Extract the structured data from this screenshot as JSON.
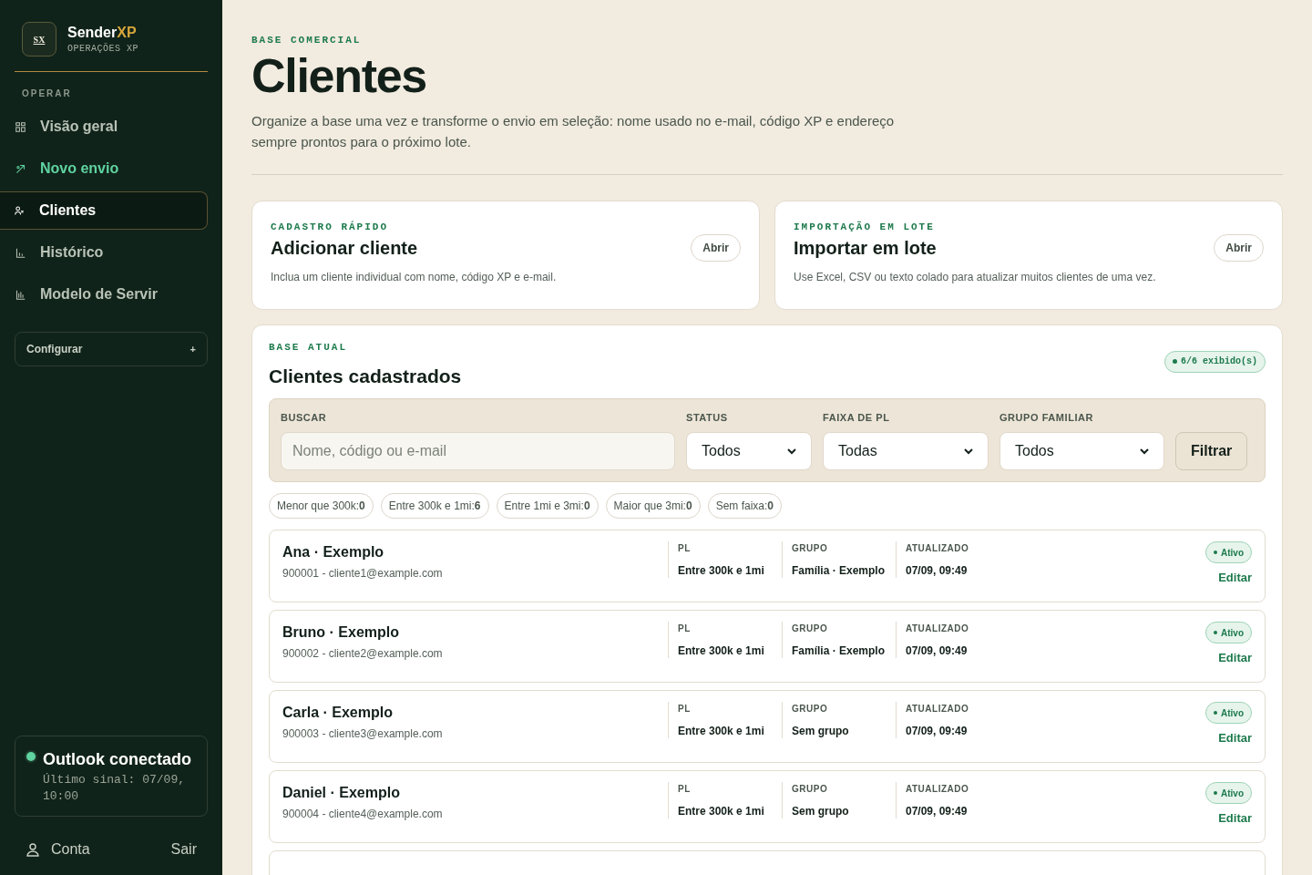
{
  "brand": {
    "logo": "SX",
    "name": "Sender",
    "name_accent": "XP",
    "subtitle": "OPERAÇÕES XP"
  },
  "sidebar": {
    "section": "OPERAR",
    "items": [
      {
        "label": "Visão geral",
        "selected": false,
        "accent": false
      },
      {
        "label": "Novo envio",
        "selected": false,
        "accent": true
      },
      {
        "label": "Clientes",
        "selected": true,
        "accent": false
      },
      {
        "label": "Histórico",
        "selected": false,
        "accent": false
      },
      {
        "label": "Modelo de Servir",
        "selected": false,
        "accent": false
      }
    ],
    "configure": {
      "label": "Configurar",
      "toggle": "+"
    },
    "status": {
      "title": "Outlook conectado",
      "detail": "Último sinal: 07/09, 10:00",
      "color": "#5fd3a0"
    },
    "account": "Conta",
    "logout": "Sair"
  },
  "header": {
    "eyebrow": "BASE COMERCIAL",
    "title": "Clientes",
    "description": "Organize a base uma vez e transforme o envio em seleção: nome usado no e-mail, código XP e endereço sempre prontos para o próximo lote."
  },
  "actions": [
    {
      "eyebrow": "CADASTRO RÁPIDO",
      "title": "Adicionar cliente",
      "description": "Inclua um cliente individual com nome, código XP e e-mail.",
      "button": "Abrir"
    },
    {
      "eyebrow": "IMPORTAÇÃO EM LOTE",
      "title": "Importar em lote",
      "description": "Use Excel, CSV ou texto colado para atualizar muitos clientes de uma vez.",
      "button": "Abrir"
    }
  ],
  "base": {
    "eyebrow": "BASE ATUAL",
    "title": "Clientes cadastrados",
    "count": "6/6 exibido(s)",
    "filters": {
      "search": {
        "label": "BUSCAR",
        "placeholder": "Nome, código ou e-mail"
      },
      "selects": [
        {
          "label": "STATUS",
          "value": "Todos"
        },
        {
          "label": "FAIXA DE PL",
          "value": "Todas"
        },
        {
          "label": "GRUPO FAMILIAR",
          "value": "Todos"
        }
      ],
      "button": "Filtrar"
    },
    "ranges": [
      {
        "label": "Menor que 300k:",
        "count": "0"
      },
      {
        "label": "Entre 300k e 1mi:",
        "count": "6"
      },
      {
        "label": "Entre 1mi e 3mi:",
        "count": "0"
      },
      {
        "label": "Maior que 3mi:",
        "count": "0"
      },
      {
        "label": "Sem faixa:",
        "count": "0"
      }
    ],
    "rows": [
      {
        "name": "Ana · Exemplo",
        "detail": "900001 - cliente1@example.com",
        "fields": [
          {
            "label": "PL",
            "value": "Entre 300k e 1mi"
          },
          {
            "label": "GRUPO",
            "value": "Família · Exemplo"
          },
          {
            "label": "ATUALIZADO",
            "value": "07/09, 09:49"
          }
        ],
        "status": "Ativo",
        "edit": "Editar"
      },
      {
        "name": "Bruno · Exemplo",
        "detail": "900002 - cliente2@example.com",
        "fields": [
          {
            "label": "PL",
            "value": "Entre 300k e 1mi"
          },
          {
            "label": "GRUPO",
            "value": "Família · Exemplo"
          },
          {
            "label": "ATUALIZADO",
            "value": "07/09, 09:49"
          }
        ],
        "status": "Ativo",
        "edit": "Editar"
      },
      {
        "name": "Carla · Exemplo",
        "detail": "900003 - cliente3@example.com",
        "fields": [
          {
            "label": "PL",
            "value": "Entre 300k e 1mi"
          },
          {
            "label": "GRUPO",
            "value": "Sem grupo"
          },
          {
            "label": "ATUALIZADO",
            "value": "07/09, 09:49"
          }
        ],
        "status": "Ativo",
        "edit": "Editar"
      },
      {
        "name": "Daniel · Exemplo",
        "detail": "900004 - cliente4@example.com",
        "fields": [
          {
            "label": "PL",
            "value": "Entre 300k e 1mi"
          },
          {
            "label": "GRUPO",
            "value": "Sem grupo"
          },
          {
            "label": "ATUALIZADO",
            "value": "07/09, 09:49"
          }
        ],
        "status": "Ativo",
        "edit": "Editar"
      }
    ]
  }
}
